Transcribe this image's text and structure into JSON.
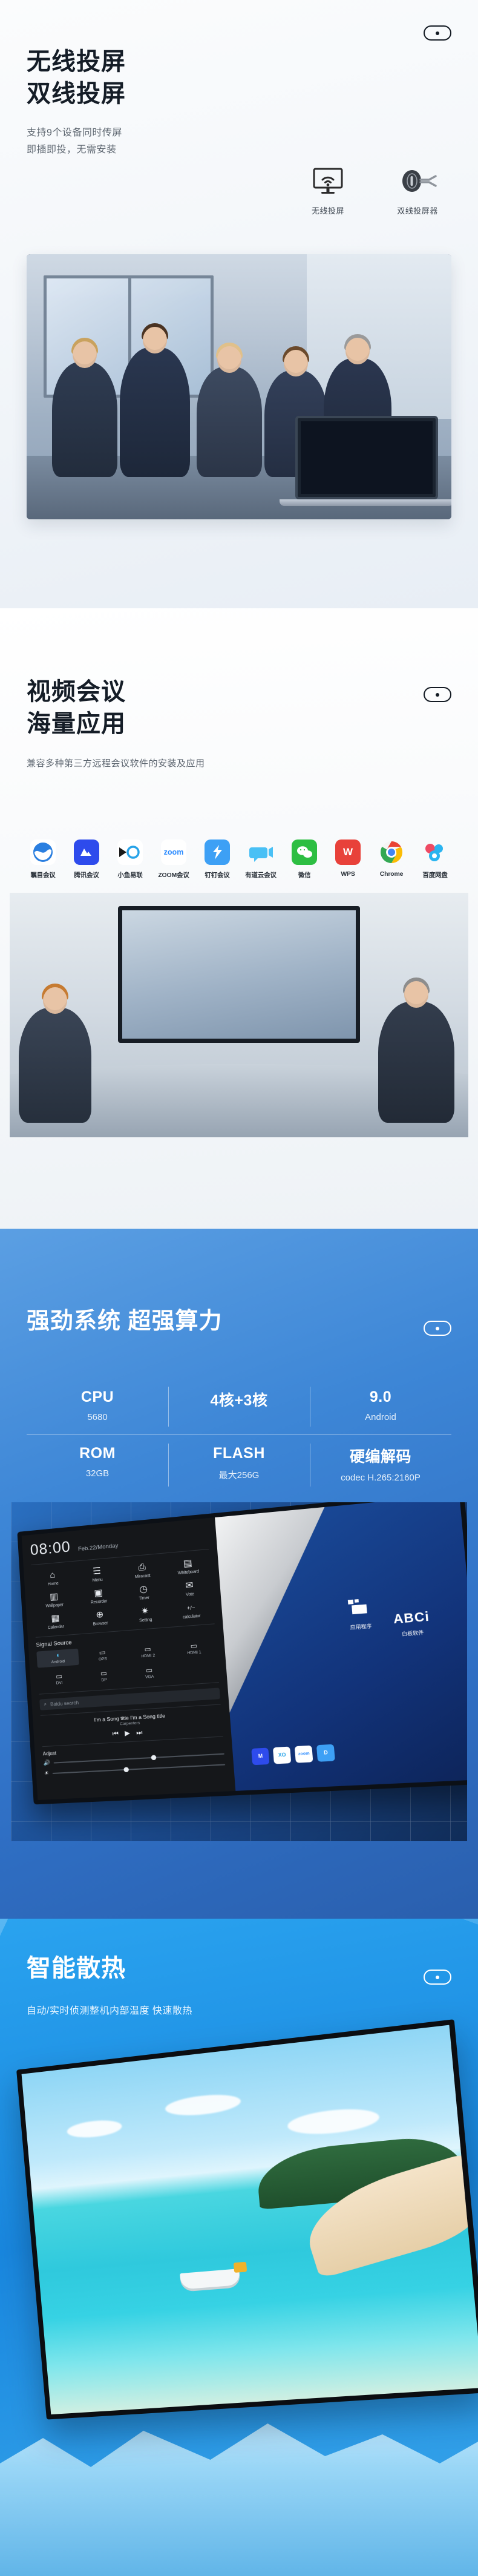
{
  "sections": {
    "cast": {
      "title_line1": "无线投屏",
      "title_line2": "双线投屏",
      "desc_line1": "支持9个设备同时传屏",
      "desc_line2": "即插即投，无需安装",
      "features": [
        {
          "icon": "monitor-wifi-icon",
          "label": "无线投屏"
        },
        {
          "icon": "dongle-icon",
          "label": "双线投屏器"
        }
      ],
      "photo_alt": "会议室投屏演示照片"
    },
    "conference": {
      "title_line1": "视频会议",
      "title_line2": "海量应用",
      "desc": "兼容多种第三方远程会议软件的安装及应用",
      "apps": [
        {
          "name": "瞩目会议",
          "icon": "zhumu-icon",
          "color": "#2b7fe0",
          "glyph": "Z"
        },
        {
          "name": "腾讯会议",
          "icon": "tencent-meeting-icon",
          "color": "#2e4bec",
          "glyph": "M"
        },
        {
          "name": "小鱼易联",
          "icon": "xiaoyu-icon",
          "color": "#ffffff",
          "glyph": "XO"
        },
        {
          "name": "ZOOM会议",
          "icon": "zoom-icon",
          "color": "#ffffff",
          "glyph": "zoom"
        },
        {
          "name": "钉钉会议",
          "icon": "dingtalk-icon",
          "color": "#3da0f5",
          "glyph": "D"
        },
        {
          "name": "有道云会议",
          "icon": "youdao-icon",
          "color": "#49c0f5",
          "glyph": "Y"
        },
        {
          "name": "微信",
          "icon": "wechat-icon",
          "color": "#2dbe42",
          "glyph": "W"
        },
        {
          "name": "WPS",
          "icon": "wps-icon",
          "color": "#e8413a",
          "glyph": "W"
        },
        {
          "name": "Chrome",
          "icon": "chrome-icon",
          "color": "#ffffff",
          "glyph": "C"
        },
        {
          "name": "百度网盘",
          "icon": "baidu-pan-icon",
          "color": "#ffffff",
          "glyph": "B"
        }
      ],
      "photo_alt": "会议室视频会议场景照片"
    },
    "spec": {
      "title": "强劲系统 超强算力",
      "rows": [
        [
          {
            "key": "CPU",
            "value": "5680"
          },
          {
            "key": "4核+3核",
            "value": ""
          },
          {
            "key": "9.0",
            "value": "Android"
          }
        ],
        [
          {
            "key": "ROM",
            "value": "32GB"
          },
          {
            "key": "FLASH",
            "value": "最大256G"
          },
          {
            "key": "硬编解码",
            "value": "codec H.265:2160P"
          }
        ]
      ],
      "ui": {
        "clock": "08:00",
        "date": "Feb.22/Monday",
        "apps": [
          {
            "label": "Home",
            "glyph": "⌂",
            "icon": "home-icon"
          },
          {
            "label": "Menu",
            "glyph": "☰",
            "icon": "menu-icon"
          },
          {
            "label": "Miracast",
            "glyph": "⎙",
            "icon": "miracast-icon"
          },
          {
            "label": "Whiteboard",
            "glyph": "▤",
            "icon": "whiteboard-icon"
          },
          {
            "label": "Wallpaper",
            "glyph": "🖼",
            "icon": "wallpaper-icon"
          },
          {
            "label": "Recorder",
            "glyph": "▣",
            "icon": "recorder-icon"
          },
          {
            "label": "Timer",
            "glyph": "⏱",
            "icon": "timer-icon"
          },
          {
            "label": "Vote",
            "glyph": "✉",
            "icon": "vote-icon"
          },
          {
            "label": "Calendar",
            "glyph": "▦",
            "icon": "calendar-icon"
          },
          {
            "label": "Browser",
            "glyph": "⊕",
            "icon": "browser-icon"
          },
          {
            "label": "Setting",
            "glyph": "✷",
            "icon": "gear-icon"
          },
          {
            "label": "calculator",
            "glyph": "+/-",
            "icon": "calculator-icon"
          }
        ],
        "signal_source_label": "Signal Source",
        "sources": [
          {
            "label": "Android",
            "selected": true
          },
          {
            "label": "OPS",
            "selected": false
          },
          {
            "label": "HDMI 2",
            "selected": false
          },
          {
            "label": "HDMI 1",
            "selected": false
          },
          {
            "label": "DVI",
            "selected": false
          },
          {
            "label": "DP",
            "selected": false
          },
          {
            "label": "VGA",
            "selected": false
          }
        ],
        "search_placeholder": "Baidu search",
        "player": {
          "title": "I'm a Song title  I'm a Song title",
          "artist": "Carpenters"
        },
        "adjust_label": "Adjust",
        "whiteboard_logo": "ABCi",
        "whiteboard_caption": "白板软件",
        "apps_caption": "应用程序",
        "dock": [
          "M",
          "XO",
          "zoom",
          "D"
        ]
      }
    },
    "cooling": {
      "title": "智能散热",
      "desc": "自动/实时侦测整机内部温度 快速散热",
      "photo_alt": "冰块中的电视屏幕展示海滩画面"
    }
  }
}
